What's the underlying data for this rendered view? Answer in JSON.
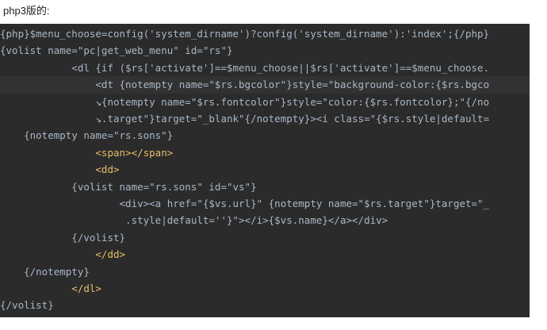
{
  "top_caption": "php3版的:",
  "code_lines": [
    "{php}$menu_choose=config('system_dirname')?config('system_dirname'):'index';{/php}",
    "{volist name=\"pc|get_web_menu\" id=\"rs\"}",
    "            <dl {if ($rs['activate']==$menu_choose||$rs['activate']==$menu_choose.",
    "                <dt {notempty name=\"$rs.bgcolor\"}style=\"background-color:{$rs.bgco",
    "                ↘{notempty name=\"$rs.fontcolor\"}style=\"color:{$rs.fontcolor};\"{/no",
    "                ↘.target\"}target=\"_blank\"{/notempty}><i class=\"{$rs.style|default=",
    "    {notempty name=\"rs.sons\"}",
    "                <span></span>",
    "                <dd>",
    "            {volist name=\"rs.sons\" id=\"vs\"}",
    "                    <div><a href=\"{$vs.url}\" {notempty name=\"$rs.target\"}target=\"_",
    "                     .style|default=''}\"></i>{$vs.name}</a></div>",
    "            {/volist}",
    "                </dd>",
    "    {/notempty}",
    "            </dl>",
    "{/volist}"
  ],
  "colors": {
    "editor_bg": "#2b2b2b",
    "tag": "#e8bf6a",
    "string": "#6a8759",
    "text": "#a9b7c6"
  }
}
